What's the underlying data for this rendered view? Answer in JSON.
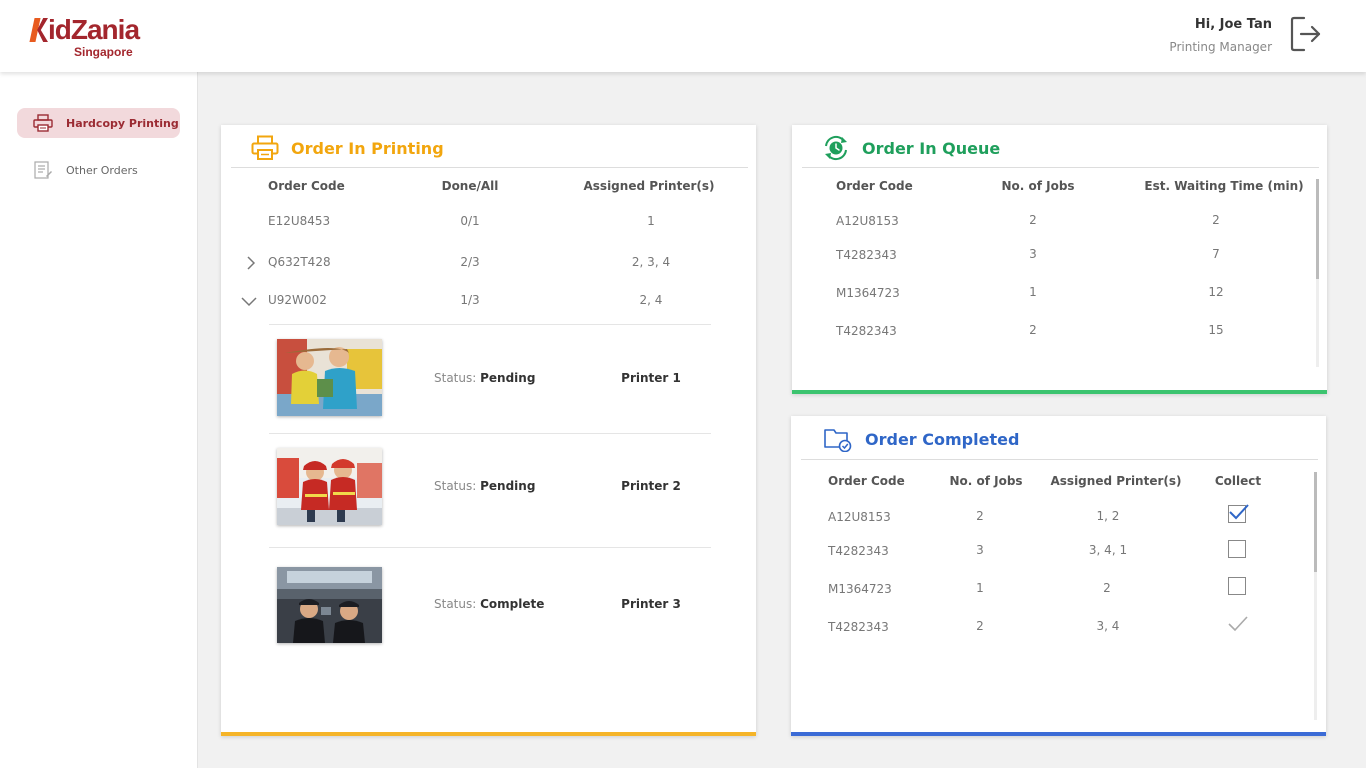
{
  "header": {
    "logo_text": "KidZania",
    "logo_subtext": "Singapore",
    "greeting": "Hi, Joe Tan",
    "role": "Printing Manager",
    "logout_icon": "logout-icon"
  },
  "sidebar": {
    "items": [
      {
        "label": "Hardcopy Printing",
        "icon": "printer-icon",
        "active": true
      },
      {
        "label": "Other Orders",
        "icon": "list-icon",
        "active": false
      }
    ]
  },
  "printing": {
    "title": "Order In Printing",
    "columns": [
      "Order Code",
      "Done/All",
      "Assigned Printer(s)"
    ],
    "rows": [
      {
        "code": "E12U8453",
        "done": "0/1",
        "printers": "1"
      },
      {
        "code": "Q632T428",
        "done": "2/3",
        "printers": "2, 3, 4"
      },
      {
        "code": "U92W002",
        "done": "1/3",
        "printers": "2, 4"
      }
    ],
    "status_prefix": "Status:",
    "jobs": [
      {
        "status": "Pending",
        "printer": "Printer 1"
      },
      {
        "status": "Pending",
        "printer": "Printer 2"
      },
      {
        "status": "Complete",
        "printer": "Printer 3"
      }
    ],
    "accent": "#f5b428"
  },
  "queue": {
    "title": "Order In Queue",
    "columns": [
      "Order Code",
      "No. of Jobs",
      "Est. Waiting Time (min)"
    ],
    "rows": [
      {
        "code": "A12U8153",
        "jobs": "2",
        "wait": "2"
      },
      {
        "code": "T4282343",
        "jobs": "3",
        "wait": "7"
      },
      {
        "code": "M1364723",
        "jobs": "1",
        "wait": "12"
      },
      {
        "code": "T4282343",
        "jobs": "2",
        "wait": "15"
      }
    ],
    "accent": "#3cc46f"
  },
  "completed": {
    "title": "Order Completed",
    "columns": [
      "Order Code",
      "No. of Jobs",
      "Assigned Printer(s)",
      "Collect"
    ],
    "rows": [
      {
        "code": "A12U8153",
        "jobs": "2",
        "printers": "1, 2",
        "collect": "checked"
      },
      {
        "code": "T4282343",
        "jobs": "3",
        "printers": "3, 4, 1",
        "collect": "unchecked"
      },
      {
        "code": "M1364723",
        "jobs": "1",
        "printers": "2",
        "collect": "unchecked"
      },
      {
        "code": "T4282343",
        "jobs": "2",
        "printers": "3, 4",
        "collect": "collected"
      }
    ],
    "accent": "#3b6bd6"
  }
}
